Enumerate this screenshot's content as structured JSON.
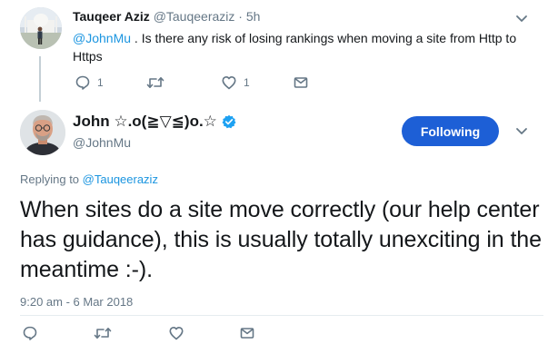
{
  "reply_tweet": {
    "author_name": "Tauqeer Aziz",
    "author_handle": "@Tauqeeraziz",
    "separator": "·",
    "time": "5h",
    "mention": "@JohnMu",
    "text": " . Is there any risk of losing rankings when moving a site from Http to Https",
    "reply_count": "1",
    "retweet_count": "",
    "like_count": "1"
  },
  "main_tweet": {
    "author_name": "John ☆.o(≧▽≦)o.☆",
    "author_handle": "@JohnMu",
    "follow_label": "Following",
    "replying_prefix": "Replying to ",
    "replying_to": "@Tauqeeraziz",
    "text": "When sites do a site move correctly (our help center has guidance), this is usually totally unexciting in the meantime :-).",
    "timestamp": "9:20 am - 6 Mar 2018"
  },
  "colors": {
    "accent": "#1d5fd6",
    "link": "#1b95e0",
    "muted": "#657786",
    "thread_line": "#c4cfd6",
    "verified": "#1da1f2"
  },
  "icons": {
    "reply": "speech-bubble-icon",
    "retweet": "retweet-arrows-icon",
    "like": "heart-icon",
    "message": "envelope-icon",
    "menu": "chevron-down-icon",
    "verified": "verified-badge-icon"
  }
}
